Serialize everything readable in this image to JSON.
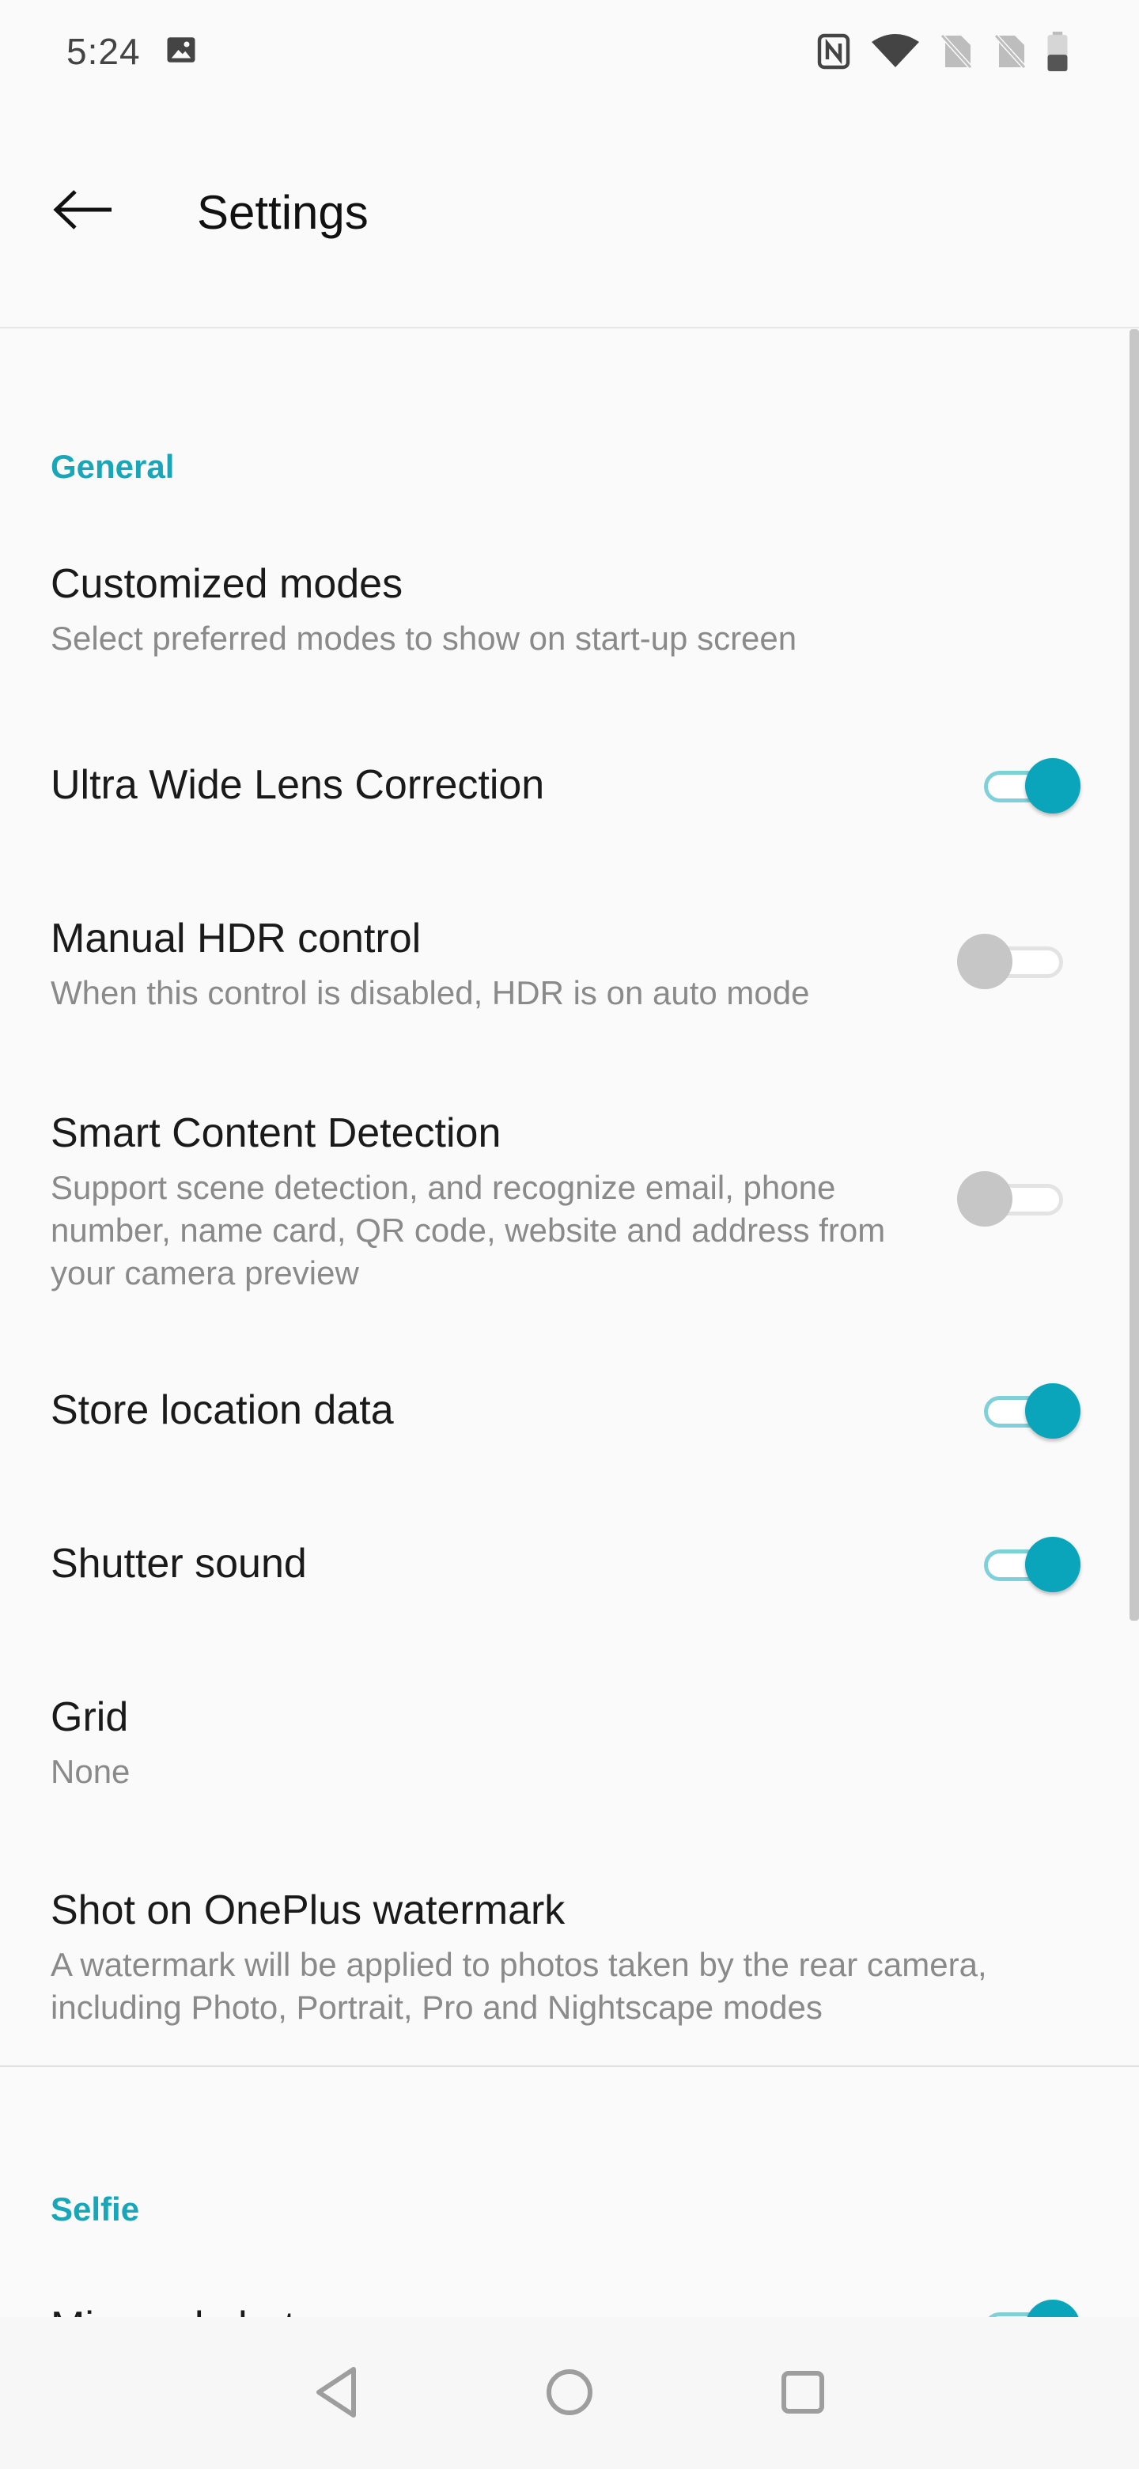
{
  "status_bar": {
    "time": "5:24",
    "left_icons": [
      "image-icon"
    ],
    "right_icons": [
      "nfc-icon",
      "wifi-icon",
      "no-sim-icon",
      "no-sim-icon",
      "battery-icon"
    ]
  },
  "app_bar": {
    "title": "Settings",
    "back_icon": "arrow-left-icon"
  },
  "colors": {
    "accent": "#0aa4bb",
    "section_header": "#18a6b8",
    "background": "#fafafa",
    "toggle_off": "#c6c6c6"
  },
  "sections": [
    {
      "header": "General",
      "items": [
        {
          "title": "Customized modes",
          "subtitle": "Select preferred modes to show on start-up screen"
        },
        {
          "title": "Ultra Wide Lens Correction",
          "toggle": true
        },
        {
          "title": "Manual HDR control",
          "subtitle": "When this control is disabled, HDR is on auto mode",
          "toggle": false
        },
        {
          "title": "Smart Content Detection",
          "subtitle_lines": [
            "Support scene detection, and recognize email, phone",
            "number, name card, QR code, website and address from",
            "your camera preview"
          ],
          "toggle": false
        },
        {
          "title": "Store location data",
          "toggle": true
        },
        {
          "title": "Shutter sound",
          "toggle": true
        },
        {
          "title": "Grid",
          "subtitle": "None"
        },
        {
          "title": "Shot on OnePlus watermark",
          "subtitle_lines": [
            "A watermark will be applied to photos taken by the rear camera,",
            "including Photo, Portrait, Pro and Nightscape modes"
          ]
        }
      ]
    },
    {
      "header": "Selfie",
      "items": [
        {
          "title": "Mirrored photos",
          "toggle": true
        }
      ]
    }
  ],
  "nav_bar": {
    "icons": [
      "nav-back-icon",
      "nav-home-icon",
      "nav-recents-icon"
    ]
  }
}
